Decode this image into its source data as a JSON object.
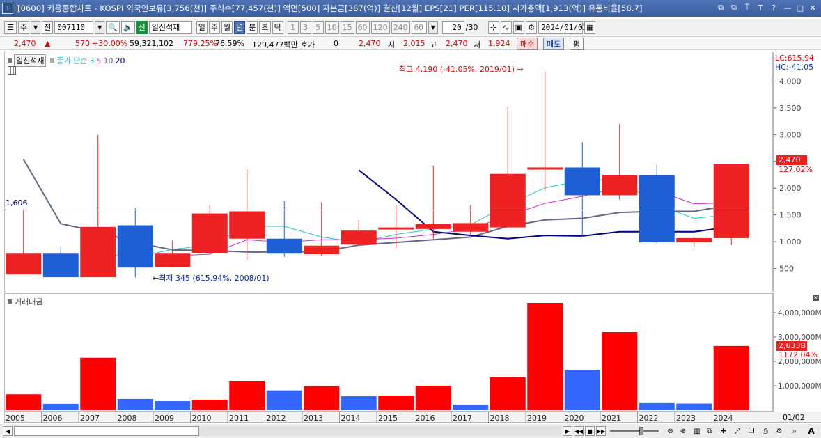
{
  "window": {
    "number": "1",
    "title": "[0600] 키움종합차트 - KOSPI 외국인보유[3,756(천)] 주식수[77,457(천)] 액면[500] 자본금[387(억)] 결산[12월] EPS[21] PER[115.10] 시가총액[1,913(억)] 유통비율[58.7]",
    "icons": [
      "⧉",
      "⧉",
      "⍑",
      "T",
      "?"
    ],
    "controls": [
      "—",
      "□",
      "✕"
    ]
  },
  "toolbar": {
    "left_buttons": [
      "주",
      "전"
    ],
    "code": "007110",
    "stock_name": "일신석재",
    "tag_new": "신",
    "periods": [
      "일",
      "주",
      "월",
      "년",
      "분",
      "초",
      "틱"
    ],
    "active_period": "년",
    "intervals": [
      "1",
      "3",
      "5",
      "10",
      "15",
      "60",
      "120",
      "240"
    ],
    "interval_value": "60",
    "count": "20",
    "count_total": "/30",
    "date": "2024/01/02"
  },
  "quote": {
    "price": "2,470",
    "change": "570",
    "change_pct": "+30.00%",
    "volume": "59,321,102",
    "vol_ratio": "779.25%",
    "turnover": "76.59%",
    "amount": "129,477백만",
    "hoga_label": "호가",
    "hoga_value": "0",
    "hoga_price": "2,470",
    "open_label": "시",
    "open": "2,015",
    "high_label": "고",
    "high": "2,470",
    "low_label": "저",
    "low": "1,924",
    "buy_label": "매수",
    "sell_label": "매도",
    "eval_label": "평"
  },
  "price_pane": {
    "legend_name": "일신석재",
    "legend_ma_label": "종가 단순",
    "ma_periods": [
      "3",
      "5",
      "10",
      "20"
    ],
    "ma_colors": [
      "#22c8c8",
      "#cc33cc",
      "#666688",
      "#000080"
    ],
    "lc": "LC:615.94",
    "hc": "HC:-41.05",
    "current_price_label": "2,470",
    "current_pct_label": "127.02%",
    "hline_label": "1,606",
    "high_note": "최고 4,190 (-41.05%, 2019/01) →",
    "low_note": "←최저 345 (615.94%, 2008/01)"
  },
  "volume_pane": {
    "legend": "거래대금",
    "current_label": "2,633B",
    "current_pct": "1172.04%"
  },
  "x_last_label": "01/02",
  "chart_data": [
    {
      "type": "candlestick",
      "name": "price",
      "categories": [
        "2005",
        "2006",
        "2007",
        "2008",
        "2009",
        "2010",
        "2011",
        "2012",
        "2013",
        "2014",
        "2015",
        "2016",
        "2017",
        "2018",
        "2019",
        "2020",
        "2021",
        "2022",
        "2023",
        "2024"
      ],
      "open": [
        400,
        790,
        350,
        1320,
        540,
        800,
        1070,
        1070,
        780,
        960,
        1280,
        1250,
        1200,
        1280,
        2360,
        2400,
        1880,
        2250,
        1000,
        1080
      ],
      "high": [
        1620,
        930,
        3010,
        1640,
        1040,
        1700,
        2360,
        1780,
        1750,
        1420,
        1700,
        2430,
        1700,
        3530,
        4190,
        2870,
        3210,
        2450,
        1090,
        2470
      ],
      "low": [
        410,
        360,
        350,
        345,
        530,
        790,
        680,
        730,
        740,
        950,
        900,
        1070,
        1130,
        1290,
        1960,
        1110,
        1800,
        990,
        920,
        950
      ],
      "close": [
        790,
        350,
        1290,
        530,
        790,
        1540,
        1580,
        790,
        940,
        1220,
        1280,
        1340,
        1360,
        2280,
        2400,
        1880,
        2250,
        1000,
        1080,
        2470
      ],
      "ma3": [
        null,
        null,
        800,
        720,
        870,
        950,
        1300,
        1300,
        1100,
        1000,
        1150,
        1250,
        1330,
        1700,
        2020,
        2160,
        2180,
        1700,
        1450,
        1520
      ],
      "ma5": [
        null,
        null,
        null,
        null,
        750,
        780,
        1050,
        1000,
        1050,
        1050,
        1080,
        1150,
        1250,
        1500,
        1730,
        1860,
        2030,
        1960,
        1720,
        1740
      ],
      "ma10": [
        2550,
        1350,
        1200,
        1000,
        860,
        850,
        820,
        820,
        830,
        950,
        1000,
        1050,
        1100,
        1300,
        1420,
        1450,
        1560,
        1580,
        1580,
        1700
      ],
      "ma20": [
        null,
        null,
        null,
        null,
        null,
        null,
        null,
        null,
        null,
        2350,
        1800,
        1200,
        1130,
        1070,
        1130,
        1120,
        1200,
        1200,
        1200,
        1290
      ],
      "yticks": [
        500,
        1000,
        1500,
        2000,
        2500,
        3000,
        3500,
        4000
      ],
      "yticklabels": [
        "500",
        "1,000",
        "1,500",
        "2,000",
        "2,500",
        "3,000",
        "3,500",
        "4,000"
      ],
      "ylim": [
        130,
        4500
      ],
      "hline": 1606
    },
    {
      "type": "bar",
      "name": "거래대금",
      "categories": [
        "2005",
        "2006",
        "2007",
        "2008",
        "2009",
        "2010",
        "2011",
        "2012",
        "2013",
        "2014",
        "2015",
        "2016",
        "2017",
        "2018",
        "2019",
        "2020",
        "2021",
        "2022",
        "2023",
        "2024"
      ],
      "values": [
        650,
        260,
        2150,
        460,
        370,
        430,
        1200,
        810,
        980,
        570,
        600,
        1000,
        230,
        1350,
        4400,
        1650,
        3200,
        290,
        270,
        2633
      ],
      "colors": [
        "#ff0000",
        "#3366ff",
        "#ff0000",
        "#3366ff",
        "#3366ff",
        "#ff0000",
        "#ff0000",
        "#3366ff",
        "#ff0000",
        "#3366ff",
        "#ff0000",
        "#ff0000",
        "#3366ff",
        "#ff0000",
        "#ff0000",
        "#3366ff",
        "#ff0000",
        "#3366ff",
        "#3366ff",
        "#ff0000"
      ],
      "yticks": [
        1000,
        2000,
        3000,
        4000
      ],
      "yticklabels": [
        "1,000,000M",
        "2,000,000M",
        "3,000,000M",
        "4,000,000M"
      ],
      "ylim": [
        0,
        4600
      ],
      "unit": "M"
    }
  ]
}
